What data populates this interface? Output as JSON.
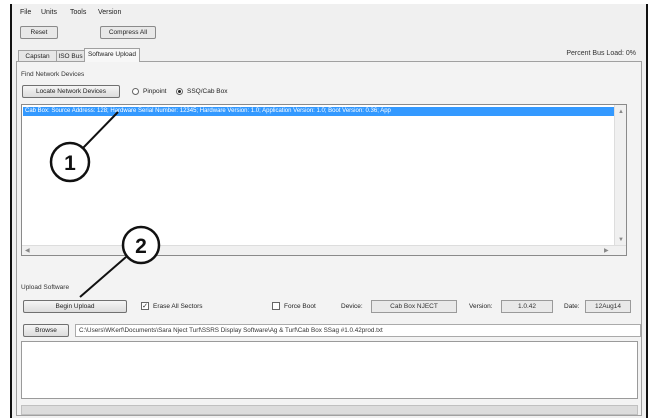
{
  "menu": [
    "File",
    "Units",
    "Tools",
    "Version"
  ],
  "toolbar": {
    "reset_label": "Reset",
    "compress_label": "Compress All"
  },
  "percent_bus_load": "Percent Bus Load: 0%",
  "tabs": [
    {
      "label": "Capstan Bus"
    },
    {
      "label": "ISO Bus"
    },
    {
      "label": "Software Upload"
    }
  ],
  "find_devices": {
    "title": "Find Network Devices",
    "locate_label": "Locate Network Devices",
    "radio_pinpoint": "Pinpoint",
    "radio_ssq": "SSQ/Cab Box",
    "list_items": [
      "Cab Box:    Source Address: 128;  Hardware Serial Number: 12345;  Hardware Version: 1.0;  Application Version: 1.0;  Boot Version: 0.36;  App"
    ]
  },
  "upload": {
    "title": "Upload Software",
    "begin_label": "Begin Upload",
    "erase_label": "Erase All Sectors",
    "erase_checked": "✓",
    "force_boot_label": "Force Boot",
    "device_label": "Device:",
    "device_value": "Cab Box NJECT",
    "version_label": "Version:",
    "version_value": "1.0.42",
    "date_label": "Date:",
    "date_value": "12Aug14",
    "browse_label": "Browse",
    "path_value": "C:\\Users\\WKerf\\Documents\\Sara Nject Turf\\SSRS Display Software\\Ag & Turf\\Cab Box SSag #1.0.42prod.txt"
  },
  "callouts": {
    "one": "1",
    "two": "2"
  },
  "colors": {
    "selection": "#3399ff",
    "window_bg": "#f0f0f0"
  }
}
